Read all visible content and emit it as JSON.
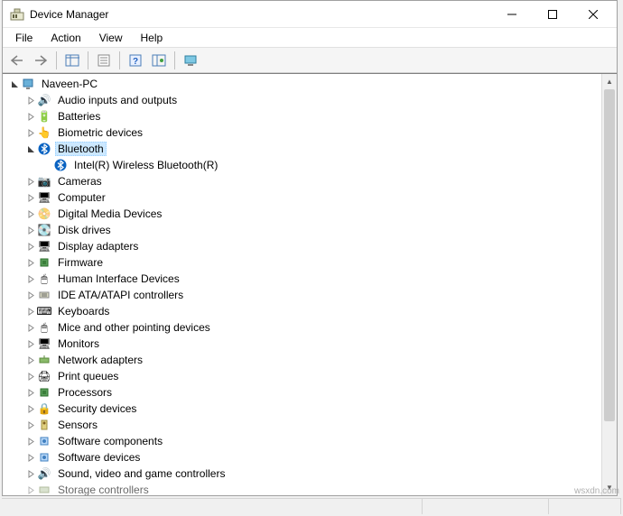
{
  "window": {
    "title": "Device Manager"
  },
  "menu": {
    "file": "File",
    "action": "Action",
    "view": "View",
    "help": "Help"
  },
  "tree": {
    "root": "Naveen-PC",
    "items": [
      {
        "label": "Audio inputs and outputs",
        "icon": "🔊"
      },
      {
        "label": "Batteries",
        "icon": "🔋"
      },
      {
        "label": "Biometric devices",
        "icon": "👆"
      },
      {
        "label": "Bluetooth",
        "icon": "bt",
        "expanded": true,
        "selected": true,
        "children": [
          {
            "label": "Intel(R) Wireless Bluetooth(R)",
            "icon": "bt"
          }
        ]
      },
      {
        "label": "Cameras",
        "icon": "📷"
      },
      {
        "label": "Computer",
        "icon": "🖥"
      },
      {
        "label": "Digital Media Devices",
        "icon": "📀"
      },
      {
        "label": "Disk drives",
        "icon": "💽"
      },
      {
        "label": "Display adapters",
        "icon": "🖥"
      },
      {
        "label": "Firmware",
        "icon": "chip"
      },
      {
        "label": "Human Interface Devices",
        "icon": "🖱"
      },
      {
        "label": "IDE ATA/ATAPI controllers",
        "icon": "ide"
      },
      {
        "label": "Keyboards",
        "icon": "⌨"
      },
      {
        "label": "Mice and other pointing devices",
        "icon": "🖱"
      },
      {
        "label": "Monitors",
        "icon": "🖥"
      },
      {
        "label": "Network adapters",
        "icon": "net"
      },
      {
        "label": "Print queues",
        "icon": "🖨"
      },
      {
        "label": "Processors",
        "icon": "chip"
      },
      {
        "label": "Security devices",
        "icon": "🔒"
      },
      {
        "label": "Sensors",
        "icon": "sensor"
      },
      {
        "label": "Software components",
        "icon": "sw"
      },
      {
        "label": "Software devices",
        "icon": "sw"
      },
      {
        "label": "Sound, video and game controllers",
        "icon": "🔊"
      },
      {
        "label": "Storage controllers",
        "icon": "ctrl",
        "cut": true
      }
    ]
  },
  "watermark": "wsxdn.com"
}
